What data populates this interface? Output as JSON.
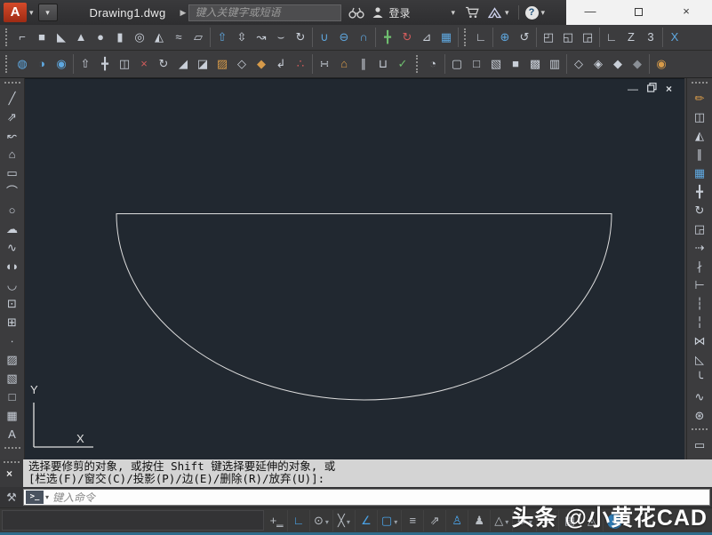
{
  "colors": {
    "accent_blue": "#4aa3e8",
    "canvas_bg": "#212830",
    "logo_red": "#c23b2a",
    "command_bg": "#d4d4d4",
    "status_bottom_line": "#2f6c8c",
    "titlebar_dark": "#333335",
    "titlebar_light": "#f2f2f2"
  },
  "title_bar": {
    "logo_letter": "A",
    "document_title": "Drawing1.dwg",
    "search_placeholder": "键入关键字或短语",
    "login_label": "登录",
    "help_glyph": "?",
    "minimize_glyph": "—",
    "close_glyph": "×"
  },
  "canvas": {
    "ucs_y_label": "Y",
    "ucs_x_label": "X",
    "doc_minimize_glyph": "—",
    "doc_close_glyph": "×"
  },
  "command": {
    "line1": "选择要修剪的对象, 或按住 Shift 键选择要延伸的对象, 或",
    "line2": "[栏选(F)/窗交(C)/投影(P)/边(E)/删除(R)/放弃(U)]:",
    "prompt_glyph": ">_",
    "input_placeholder": "键入命令",
    "close_glyph": "×"
  },
  "watermark_text": "头条 @小黄花CAD",
  "toolbars": {
    "top_row1": [
      {
        "t": "grip"
      },
      {
        "n": "polysolid",
        "g": "⌐"
      },
      {
        "n": "box",
        "g": "■"
      },
      {
        "n": "wedge",
        "g": "◣"
      },
      {
        "n": "cone",
        "g": "▲"
      },
      {
        "n": "sphere",
        "g": "●"
      },
      {
        "n": "cylinder",
        "g": "▮"
      },
      {
        "n": "torus",
        "g": "◎"
      },
      {
        "n": "pyramid",
        "g": "◭"
      },
      {
        "n": "helix",
        "g": "≈"
      },
      {
        "n": "planar-surface",
        "g": "▱"
      },
      {
        "t": "sep"
      },
      {
        "n": "extrude",
        "g": "⇧",
        "c": "blue"
      },
      {
        "n": "press-pull",
        "g": "⇳"
      },
      {
        "n": "sweep",
        "g": "↝"
      },
      {
        "n": "loft",
        "g": "⌣"
      },
      {
        "n": "revolve",
        "g": "↻"
      },
      {
        "t": "sep"
      },
      {
        "n": "union",
        "g": "∪",
        "c": "blue"
      },
      {
        "n": "subtract",
        "g": "⊖",
        "c": "blue"
      },
      {
        "n": "intersect",
        "g": "∩",
        "c": "blue"
      },
      {
        "t": "sep"
      },
      {
        "n": "3d-move",
        "g": "╋",
        "c": "green"
      },
      {
        "n": "3d-rotate",
        "g": "↻",
        "c": "red"
      },
      {
        "n": "3d-align",
        "g": "⊿"
      },
      {
        "n": "3d-array",
        "g": "▦",
        "c": "blue"
      },
      {
        "t": "sep"
      },
      {
        "t": "grip"
      },
      {
        "n": "ucs",
        "g": "∟"
      },
      {
        "t": "sep"
      },
      {
        "n": "ucs-world",
        "g": "⊕",
        "c": "blue"
      },
      {
        "n": "ucs-previous",
        "g": "↺"
      },
      {
        "t": "sep"
      },
      {
        "n": "ucs-face",
        "g": "◰"
      },
      {
        "n": "ucs-object",
        "g": "◱"
      },
      {
        "n": "ucs-view",
        "g": "◲"
      },
      {
        "t": "sep"
      },
      {
        "n": "ucs-origin",
        "g": "∟"
      },
      {
        "n": "ucs-zaxis",
        "g": "Z"
      },
      {
        "n": "ucs-3point",
        "g": "3"
      },
      {
        "t": "sep"
      },
      {
        "n": "ucs-x",
        "g": "X",
        "c": "blue"
      }
    ],
    "top_row2": [
      {
        "t": "grip"
      },
      {
        "n": "union-solid",
        "g": "◍",
        "c": "blue"
      },
      {
        "n": "subtract-solid",
        "g": "◑",
        "c": "blue"
      },
      {
        "n": "intersect-solid",
        "g": "◉",
        "c": "blue"
      },
      {
        "t": "sep"
      },
      {
        "n": "extrude-faces",
        "g": "⇧"
      },
      {
        "n": "move-faces",
        "g": "╋"
      },
      {
        "n": "offset-faces",
        "g": "◫"
      },
      {
        "n": "delete-faces",
        "g": "×",
        "c": "red"
      },
      {
        "n": "rotate-faces",
        "g": "↻"
      },
      {
        "n": "taper-faces",
        "g": "◢"
      },
      {
        "n": "copy-faces",
        "g": "◪"
      },
      {
        "n": "color-faces",
        "g": "▨",
        "c": "orange"
      },
      {
        "n": "copy-edges",
        "g": "◇"
      },
      {
        "n": "color-edges",
        "g": "◆",
        "c": "orange"
      },
      {
        "n": "imprint",
        "g": "↲"
      },
      {
        "n": "clean",
        "g": "∴",
        "c": "red"
      },
      {
        "t": "sep"
      },
      {
        "n": "separate",
        "g": "∺"
      },
      {
        "n": "shell",
        "g": "⌂",
        "c": "orange"
      },
      {
        "n": "slice",
        "g": "∥"
      },
      {
        "n": "thicken",
        "g": "⊔"
      },
      {
        "n": "check",
        "g": "✓",
        "c": "green"
      },
      {
        "t": "grip"
      },
      {
        "n": "render",
        "g": "◔"
      },
      {
        "t": "sep"
      },
      {
        "n": "vs-2d-wireframe",
        "g": "▢"
      },
      {
        "n": "vs-wireframe",
        "g": "□"
      },
      {
        "n": "vs-hidden",
        "g": "▧"
      },
      {
        "n": "vs-realistic",
        "g": "■"
      },
      {
        "n": "vs-conceptual",
        "g": "▩"
      },
      {
        "n": "vs-shaded",
        "g": "▥"
      },
      {
        "t": "sep"
      },
      {
        "n": "render-preset-draft",
        "g": "◇"
      },
      {
        "n": "render-preset-low",
        "g": "◈"
      },
      {
        "n": "render-preset-medium",
        "g": "◆"
      },
      {
        "n": "render-preset-high",
        "g": "◆",
        "c": "dim"
      },
      {
        "t": "sep"
      },
      {
        "n": "render-camera",
        "g": "◉",
        "c": "orange"
      }
    ],
    "draw_left": [
      {
        "t": "grip"
      },
      {
        "n": "line",
        "g": "╱"
      },
      {
        "n": "construction-line",
        "g": "⇗"
      },
      {
        "n": "polyline",
        "g": "↜"
      },
      {
        "n": "polygon",
        "g": "⌂"
      },
      {
        "n": "rectangle",
        "g": "▭"
      },
      {
        "n": "arc",
        "g": "⌒"
      },
      {
        "n": "circle",
        "g": "○"
      },
      {
        "n": "revision-cloud",
        "g": "☁"
      },
      {
        "n": "spline",
        "g": "∿"
      },
      {
        "n": "ellipse",
        "g": "◖◗"
      },
      {
        "n": "ellipse-arc",
        "g": "◡"
      },
      {
        "n": "insert-block",
        "g": "⊡"
      },
      {
        "n": "make-block",
        "g": "⊞"
      },
      {
        "n": "point",
        "g": "∙"
      },
      {
        "n": "hatch",
        "g": "▨"
      },
      {
        "n": "gradient",
        "g": "▧"
      },
      {
        "n": "region",
        "g": "□"
      },
      {
        "n": "table",
        "g": "▦"
      },
      {
        "n": "mtext",
        "g": "A"
      },
      {
        "t": "grip"
      }
    ],
    "modify_right": [
      {
        "t": "grip"
      },
      {
        "n": "erase",
        "g": "✏",
        "c": "orange"
      },
      {
        "n": "copy",
        "g": "◫"
      },
      {
        "n": "mirror",
        "g": "◭"
      },
      {
        "n": "offset",
        "g": "∥"
      },
      {
        "n": "array",
        "g": "▦",
        "c": "blue"
      },
      {
        "n": "move",
        "g": "╋"
      },
      {
        "n": "rotate",
        "g": "↻"
      },
      {
        "n": "scale",
        "g": "◲"
      },
      {
        "n": "stretch",
        "g": "⇢"
      },
      {
        "n": "trim",
        "g": "∤"
      },
      {
        "n": "extend",
        "g": "⊢"
      },
      {
        "n": "break-at-point",
        "g": "┆"
      },
      {
        "n": "break",
        "g": "╎"
      },
      {
        "n": "join",
        "g": "⋈"
      },
      {
        "n": "chamfer",
        "g": "◺"
      },
      {
        "n": "fillet",
        "g": "╰"
      },
      {
        "n": "blend-curves",
        "g": "∿"
      },
      {
        "n": "explode",
        "g": "⊛"
      },
      {
        "t": "grip"
      },
      {
        "n": "floating-toolbar",
        "g": "▭"
      }
    ],
    "status": [
      {
        "n": "snap-mode",
        "g": "+‗"
      },
      {
        "n": "ortho-mode",
        "g": "∟",
        "on": true
      },
      {
        "n": "polar-tracking",
        "g": "⊙",
        "arrow": true
      },
      {
        "n": "isometric-drafting",
        "g": "╳",
        "arrow": true
      },
      {
        "n": "object-snap-tracking",
        "g": "∠",
        "on": true
      },
      {
        "n": "object-snap",
        "g": "▢",
        "on": true,
        "arrow": true
      },
      {
        "n": "lineweight",
        "g": "≡"
      },
      {
        "n": "selection-cycling",
        "g": "⇗"
      },
      {
        "n": "annotation-visibility",
        "g": "♙",
        "on": true
      },
      {
        "n": "autoscale",
        "g": "♟"
      },
      {
        "n": "annotation-scale",
        "g": "△",
        "arrow": true
      },
      {
        "n": "workspace-switching",
        "g": "⚙",
        "arrow": true
      },
      {
        "n": "annotation-monitor",
        "g": "+"
      },
      {
        "n": "isolate-objects",
        "g": "▤"
      },
      {
        "n": "hardware-acceleration",
        "g": "◬"
      },
      {
        "n": "customize",
        "g": "✓",
        "round": true,
        "on": true
      }
    ]
  }
}
